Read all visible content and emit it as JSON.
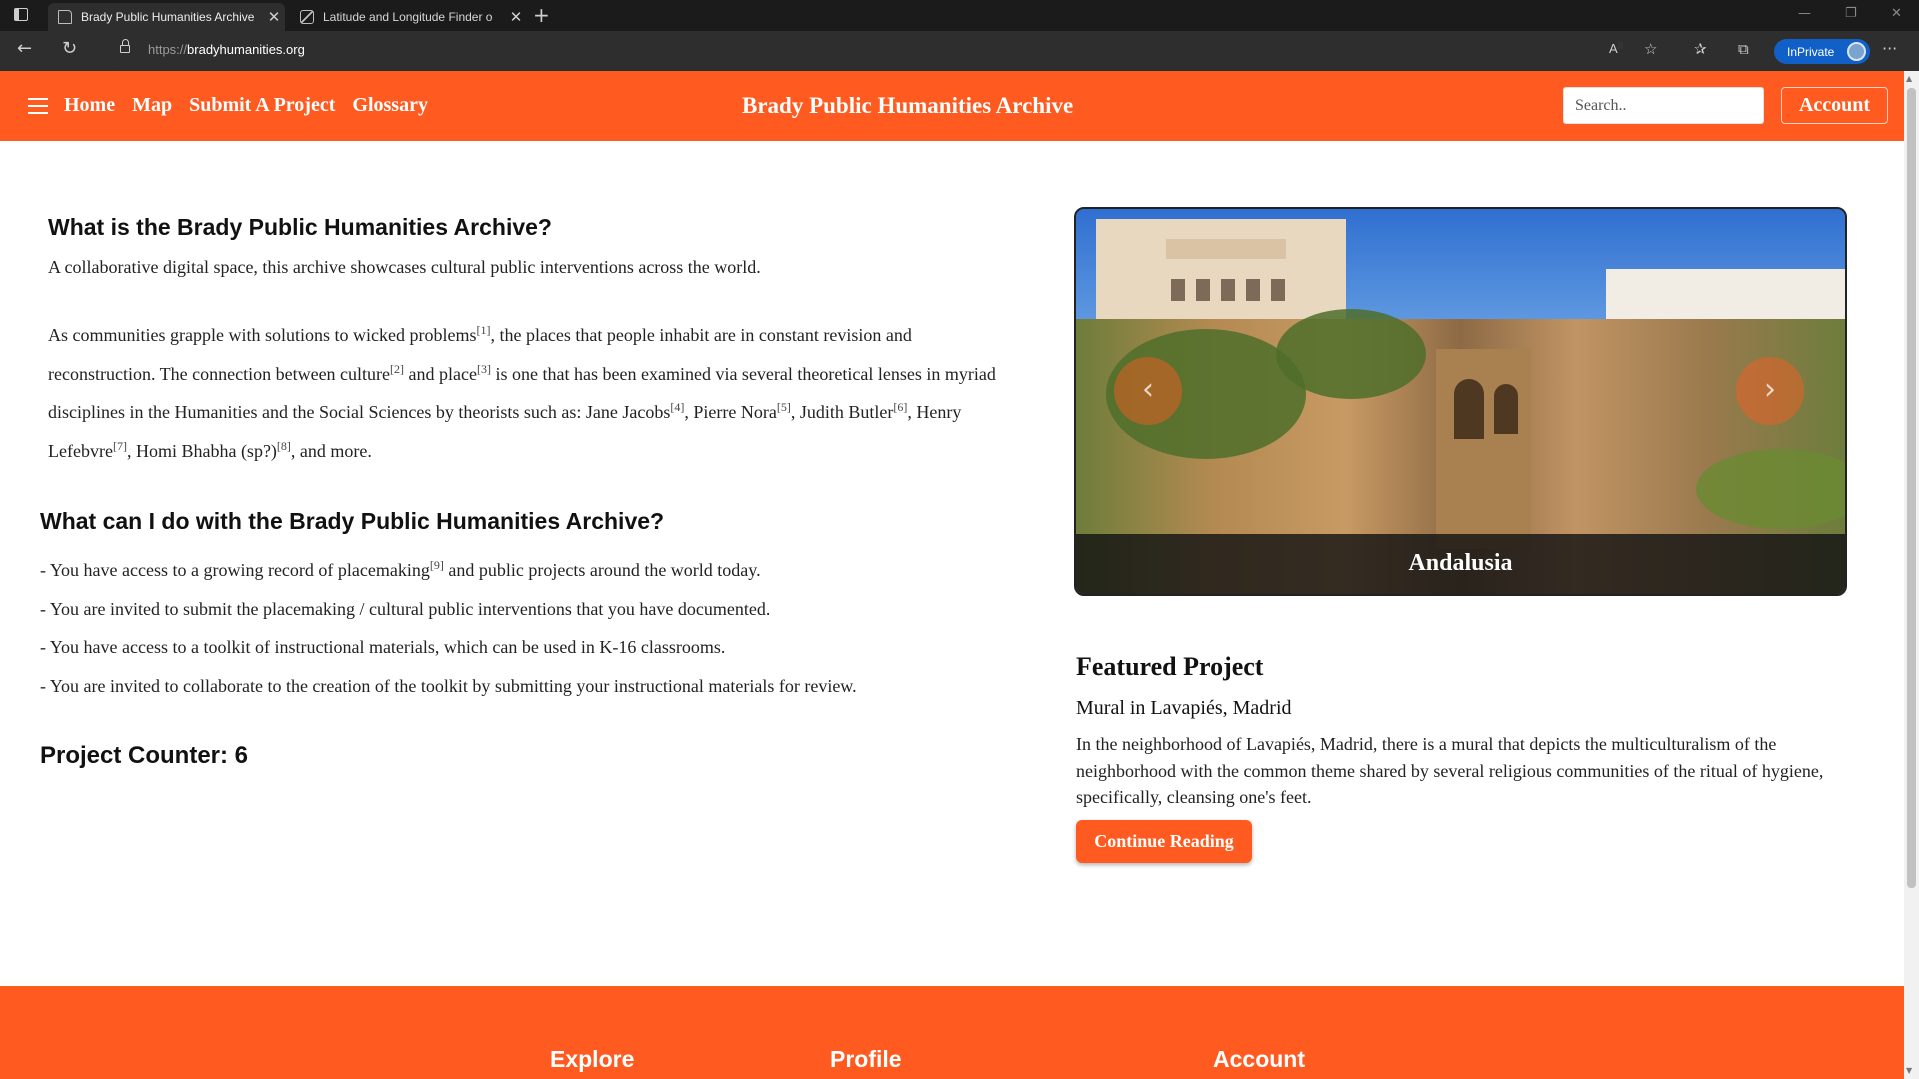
{
  "browser": {
    "tabs": [
      {
        "title": "Brady Public Humanities Archive",
        "active": true
      },
      {
        "title": "Latitude and Longitude Finder o",
        "active": false
      }
    ],
    "url_protocol": "https://",
    "url_host": "bradyhumanities.org",
    "inprivate_label": "InPrivate"
  },
  "header": {
    "nav": [
      "Home",
      "Map",
      "Submit A Project",
      "Glossary"
    ],
    "title": "Brady Public Humanities Archive",
    "search_placeholder": "Search..",
    "account_label": "Account"
  },
  "intro": {
    "heading1": "What is the Brady Public Humanities Archive?",
    "lead": "A collaborative digital space, this archive showcases cultural public interventions across the world.",
    "body_parts": [
      "As communities grapple with solutions to wicked problems",
      "[1]",
      ", the places that people inhabit are in constant revision and reconstruction. The connection between culture",
      "[2]",
      " and place",
      "[3]",
      " is one that has been examined via several theoretical lenses in myriad disciplines in the Humanities and the Social Sciences by theorists such as: Jane Jacobs",
      "[4]",
      ", Pierre Nora",
      "[5]",
      ", Judith Butler",
      "[6]",
      ", Henry Lefebvre",
      "[7]",
      ", Homi Bhabha (sp?)",
      "[8]",
      ", and more."
    ],
    "heading2": "What can I do with the Brady Public Humanities Archive?",
    "bullets": [
      {
        "text": "- You have access to a growing record of placemaking",
        "sup": "[9]",
        "tail": " and public projects around the world today."
      },
      {
        "text": "- You are invited to submit the placemaking / cultural public interventions that you have documented.",
        "sup": "",
        "tail": ""
      },
      {
        "text": "- You have access to a toolkit of instructional materials, which can be used in K-16 classrooms.",
        "sup": "",
        "tail": ""
      },
      {
        "text": "- You are invited to collaborate to the creation of the toolkit by submitting your instructional materials for review.",
        "sup": "",
        "tail": ""
      }
    ],
    "counter": "Project Counter: 6"
  },
  "carousel": {
    "caption": "Andalusia",
    "prev_glyph": "‹",
    "next_glyph": "›"
  },
  "featured": {
    "heading": "Featured Project",
    "title": "Mural in Lavapiés, Madrid",
    "description": "In the neighborhood of Lavapiés, Madrid, there is a mural that depicts the multiculturalism of the neighborhood with the common theme shared by several religious communities of the ritual of hygiene, specifically, cleansing one's feet.",
    "button": "Continue Reading"
  },
  "footer": {
    "columns": [
      "Explore",
      "Profile",
      "Account"
    ]
  },
  "colors": {
    "brand": "#ff5a1f",
    "inprivate": "#1160c7"
  }
}
